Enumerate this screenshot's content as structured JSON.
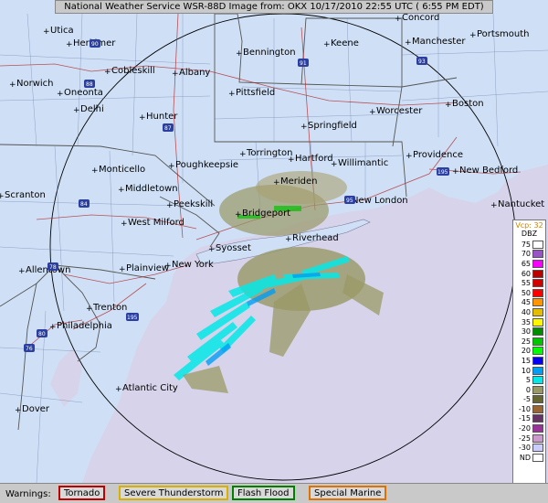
{
  "title": "National Weather Service WSR-88D Image from: OKX 10/17/2010  22:55 UTC ( 6:55 PM EDT)",
  "legend": {
    "vcp_label": "Vcp: 32",
    "unit": "DBZ",
    "levels": [
      {
        "label": "75",
        "color": "#ffffff"
      },
      {
        "label": "70",
        "color": "#9854c6"
      },
      {
        "label": "65",
        "color": "#f800fd"
      },
      {
        "label": "60",
        "color": "#bc0000"
      },
      {
        "label": "55",
        "color": "#d40000"
      },
      {
        "label": "50",
        "color": "#fd0000"
      },
      {
        "label": "45",
        "color": "#fd9500"
      },
      {
        "label": "40",
        "color": "#e5bc00"
      },
      {
        "label": "35",
        "color": "#fdf802"
      },
      {
        "label": "30",
        "color": "#008e00"
      },
      {
        "label": "25",
        "color": "#01c501"
      },
      {
        "label": "20",
        "color": "#02fd02"
      },
      {
        "label": "15",
        "color": "#0300f4"
      },
      {
        "label": "10",
        "color": "#019ff4"
      },
      {
        "label": "5",
        "color": "#04e9e7"
      },
      {
        "label": "0",
        "color": "#999966"
      },
      {
        "label": "-5",
        "color": "#666633"
      },
      {
        "label": "-10",
        "color": "#996633"
      },
      {
        "label": "-15",
        "color": "#663366"
      },
      {
        "label": "-20",
        "color": "#993399"
      },
      {
        "label": "-25",
        "color": "#cc99cc"
      },
      {
        "label": "-30",
        "color": "#ccccff"
      },
      {
        "label": "ND",
        "color": "#ffffff"
      }
    ]
  },
  "warnings": {
    "label": "Warnings:",
    "items": [
      {
        "label": "Tornado",
        "color": "#ff0000"
      },
      {
        "label": "Severe Thunderstorm",
        "color": "#ffcc00"
      },
      {
        "label": "Flash Flood",
        "color": "#00aa00"
      },
      {
        "label": "Special Marine",
        "color": "#ff8800"
      }
    ]
  },
  "cities": [
    "Utica",
    "Herkimer",
    "Concord",
    "Portsmouth",
    "Bennington",
    "Keene",
    "Manchester",
    "Norwich",
    "Oneonta",
    "Cobleskill",
    "Albany",
    "Delhi",
    "Pittsfield",
    "Hunter",
    "Worcester",
    "Boston",
    "Springfield",
    "Torrington",
    "Hartford",
    "Willimantic",
    "Providence",
    "Monticello",
    "Poughkeepsie",
    "New Bedford",
    "Meriden",
    "Middletown",
    "Scranton",
    "New London",
    "Nantucket",
    "Peekskill",
    "West Milford",
    "Bridgeport",
    "Riverhead",
    "Syosset",
    "Allentown",
    "Plainview",
    "New York",
    "Trenton",
    "Philadelphia",
    "Atlantic City",
    "Dover"
  ],
  "routes": [
    "90",
    "91",
    "93",
    "88",
    "87",
    "195",
    "95",
    "84",
    "78",
    "76",
    "80"
  ]
}
